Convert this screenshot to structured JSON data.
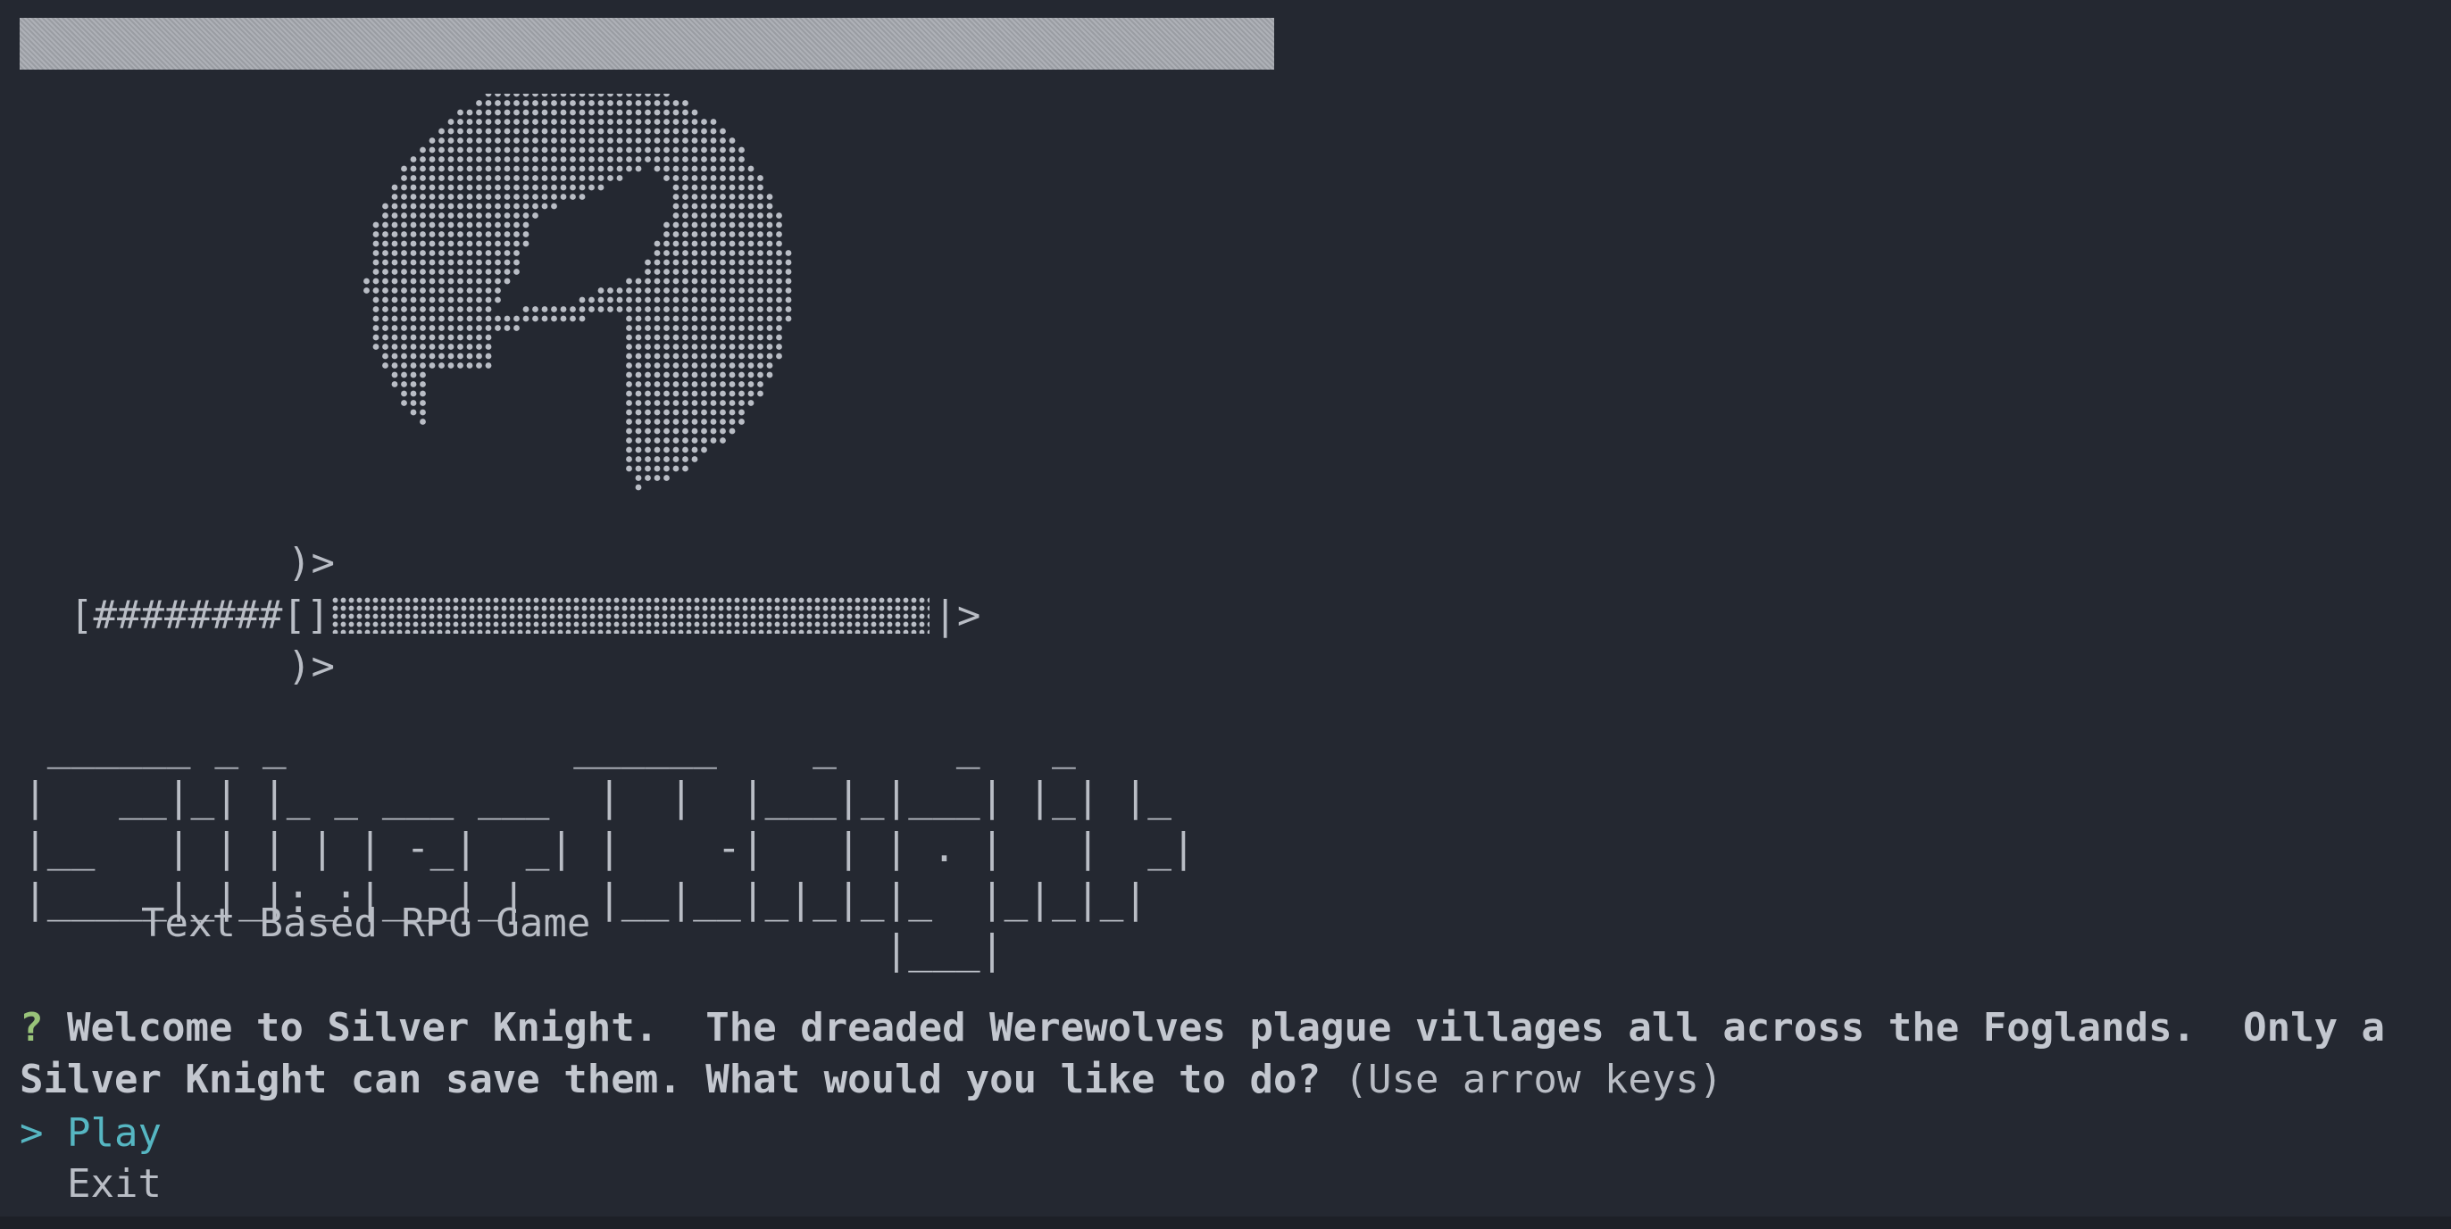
{
  "title_bar": {
    "progress_label": ""
  },
  "art": {
    "icon": "werewolf-moon-dot-art"
  },
  "sword": {
    "guard_top": ")>",
    "hilt": "[########[]",
    "tip": "|>",
    "guard_bottom": ")>"
  },
  "banner": {
    "text": " ______ _ _            ______    _     _   _\n|   __|_| |_ _ ___ ___  |  |  |___|_|___| |_| |_\n|__   | | | | | -_|  _| |    -|   | | . |   |  _|\n|_____|_|_|:_:|___|_|   |__|__|_|_|_|_  |_|_|_|\n                                    |___|",
    "subtitle": "Text Based RPG Game"
  },
  "prompt": {
    "marker": "?",
    "message": "Welcome to Silver Knight.  The dreaded Werewolves plague villages all across the Foglands.  Only a Silver Knight can save them. What would you like to do?",
    "hint": "(Use arrow keys)"
  },
  "menu": {
    "items": [
      {
        "cursor": ">",
        "label": "Play",
        "selected": true
      },
      {
        "cursor": " ",
        "label": "Exit",
        "selected": false
      }
    ]
  },
  "colors": {
    "background": "#242831",
    "text": "#b9bdc5",
    "question_mark": "#98c379",
    "selected": "#56b6c2"
  }
}
